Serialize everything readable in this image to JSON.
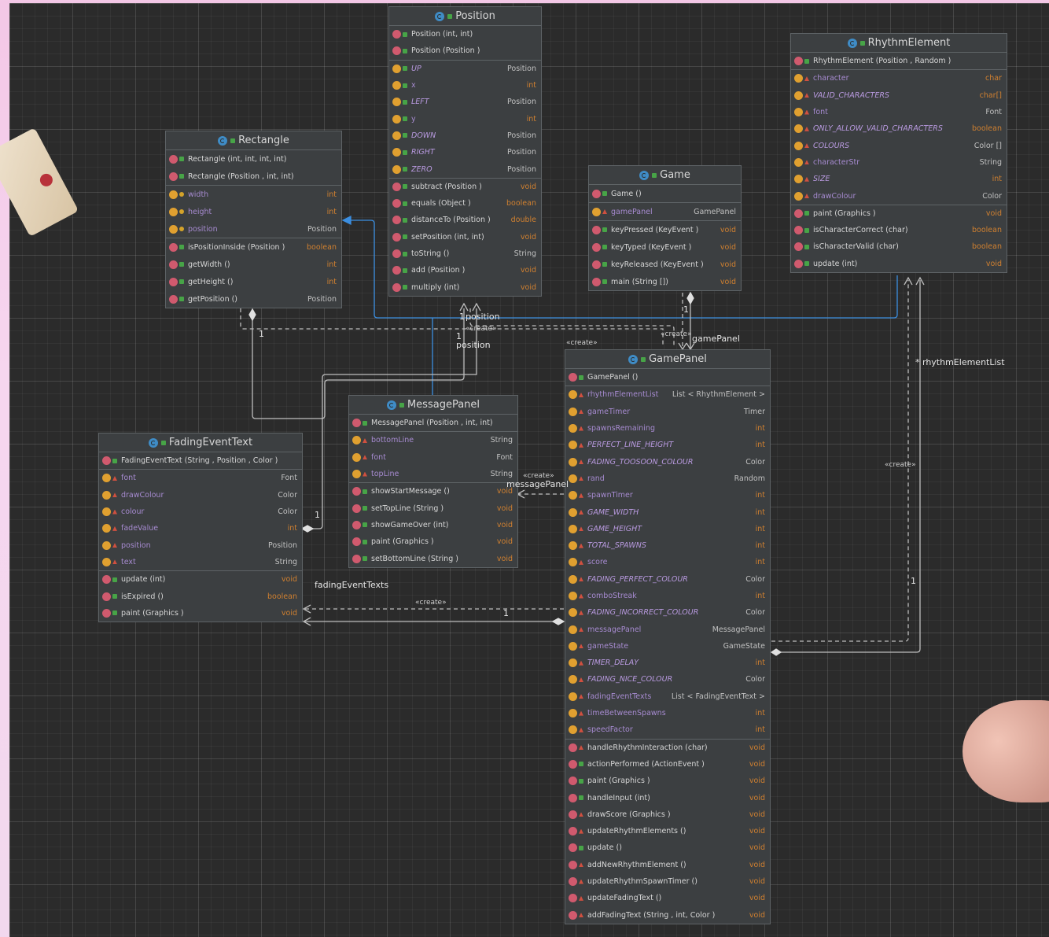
{
  "diagram": {
    "classes": [
      {
        "id": "Position",
        "name": "Position",
        "sections": [
          [
            {
              "k": "m",
              "v": "pub",
              "name": "Position",
              "args": "(int, int)",
              "type": ""
            },
            {
              "k": "m",
              "v": "pub",
              "name": "Position",
              "args": "(Position )",
              "type": ""
            }
          ],
          [
            {
              "k": "f",
              "v": "pub",
              "static": true,
              "name": "UP",
              "args": "",
              "type": "Position"
            },
            {
              "k": "f",
              "v": "pub",
              "name": "x",
              "args": "",
              "type": "int"
            },
            {
              "k": "f",
              "v": "pub",
              "static": true,
              "name": "LEFT",
              "args": "",
              "type": "Position"
            },
            {
              "k": "f",
              "v": "pub",
              "name": "y",
              "args": "",
              "type": "int"
            },
            {
              "k": "f",
              "v": "pub",
              "static": true,
              "name": "DOWN",
              "args": "",
              "type": "Position"
            },
            {
              "k": "f",
              "v": "pub",
              "static": true,
              "name": "RIGHT",
              "args": "",
              "type": "Position"
            },
            {
              "k": "f",
              "v": "pub",
              "static": true,
              "name": "ZERO",
              "args": "",
              "type": "Position"
            }
          ],
          [
            {
              "k": "m",
              "v": "pub",
              "name": "subtract",
              "args": "(Position )",
              "type": "void"
            },
            {
              "k": "m",
              "v": "pub",
              "name": "equals",
              "args": "(Object )",
              "type": "boolean"
            },
            {
              "k": "m",
              "v": "pub",
              "name": "distanceTo",
              "args": "(Position )",
              "type": "double"
            },
            {
              "k": "m",
              "v": "pub",
              "name": "setPosition",
              "args": "(int, int)",
              "type": "void"
            },
            {
              "k": "m",
              "v": "pub",
              "name": "toString",
              "args": "()",
              "type": "String"
            },
            {
              "k": "m",
              "v": "pub",
              "name": "add",
              "args": "(Position )",
              "type": "void"
            },
            {
              "k": "m",
              "v": "pub",
              "name": "multiply",
              "args": "(int)",
              "type": "void"
            }
          ]
        ]
      },
      {
        "id": "RhythmElement",
        "name": "RhythmElement",
        "sections": [
          [
            {
              "k": "m",
              "v": "pub",
              "name": "RhythmElement",
              "args": "(Position , Random )",
              "type": ""
            }
          ],
          [
            {
              "k": "f",
              "v": "priv",
              "name": "character",
              "args": "",
              "type": "char"
            },
            {
              "k": "f",
              "v": "priv",
              "static": true,
              "name": "VALID_CHARACTERS",
              "args": "",
              "type": "char[]"
            },
            {
              "k": "f",
              "v": "priv",
              "name": "font",
              "args": "",
              "type": "Font"
            },
            {
              "k": "f",
              "v": "priv",
              "static": true,
              "name": "ONLY_ALLOW_VALID_CHARACTERS",
              "args": "",
              "type": "boolean"
            },
            {
              "k": "f",
              "v": "priv",
              "static": true,
              "name": "COLOURS",
              "args": "",
              "type": "Color []"
            },
            {
              "k": "f",
              "v": "priv",
              "name": "characterStr",
              "args": "",
              "type": "String"
            },
            {
              "k": "f",
              "v": "priv",
              "static": true,
              "name": "SIZE",
              "args": "",
              "type": "int"
            },
            {
              "k": "f",
              "v": "priv",
              "name": "drawColour",
              "args": "",
              "type": "Color"
            }
          ],
          [
            {
              "k": "m",
              "v": "pub",
              "name": "paint",
              "args": "(Graphics )",
              "type": "void"
            },
            {
              "k": "m",
              "v": "pub",
              "name": "isCharacterCorrect",
              "args": "(char)",
              "type": "boolean"
            },
            {
              "k": "m",
              "v": "pub",
              "name": "isCharacterValid",
              "args": "(char)",
              "type": "boolean"
            },
            {
              "k": "m",
              "v": "pub",
              "name": "update",
              "args": "(int)",
              "type": "void"
            }
          ]
        ]
      },
      {
        "id": "Rectangle",
        "name": "Rectangle",
        "sections": [
          [
            {
              "k": "m",
              "v": "pub",
              "name": "Rectangle",
              "args": "(int, int, int, int)",
              "type": ""
            },
            {
              "k": "m",
              "v": "pub",
              "name": "Rectangle",
              "args": "(Position , int, int)",
              "type": ""
            }
          ],
          [
            {
              "k": "f",
              "v": "prot",
              "name": "width",
              "args": "",
              "type": "int"
            },
            {
              "k": "f",
              "v": "prot",
              "name": "height",
              "args": "",
              "type": "int"
            },
            {
              "k": "f",
              "v": "prot",
              "name": "position",
              "args": "",
              "type": "Position"
            }
          ],
          [
            {
              "k": "m",
              "v": "pub",
              "name": "isPositionInside",
              "args": "(Position )",
              "type": "boolean"
            },
            {
              "k": "m",
              "v": "pub",
              "name": "getWidth",
              "args": "()",
              "type": "int"
            },
            {
              "k": "m",
              "v": "pub",
              "name": "getHeight",
              "args": "()",
              "type": "int"
            },
            {
              "k": "m",
              "v": "pub",
              "name": "getPosition",
              "args": "()",
              "type": "Position"
            }
          ]
        ]
      },
      {
        "id": "Game",
        "name": "Game",
        "sections": [
          [
            {
              "k": "m",
              "v": "pub",
              "name": "Game",
              "args": "()",
              "type": ""
            }
          ],
          [
            {
              "k": "f",
              "v": "priv",
              "name": "gamePanel",
              "args": "",
              "type": "GamePanel"
            }
          ],
          [
            {
              "k": "m",
              "v": "pub",
              "name": "keyPressed",
              "args": "(KeyEvent )",
              "type": "void"
            },
            {
              "k": "m",
              "v": "pub",
              "name": "keyTyped",
              "args": "(KeyEvent )",
              "type": "void"
            },
            {
              "k": "m",
              "v": "pub",
              "name": "keyReleased",
              "args": "(KeyEvent )",
              "type": "void"
            },
            {
              "k": "m",
              "v": "pub",
              "name": "main",
              "args": "(String [])",
              "type": "void"
            }
          ]
        ]
      },
      {
        "id": "GamePanel",
        "name": "GamePanel",
        "sections": [
          [
            {
              "k": "m",
              "v": "pub",
              "name": "GamePanel",
              "args": "()",
              "type": ""
            }
          ],
          [
            {
              "k": "f",
              "v": "priv",
              "name": "rhythmElementList",
              "args": "",
              "type": "List < RhythmElement >"
            },
            {
              "k": "f",
              "v": "priv",
              "name": "gameTimer",
              "args": "",
              "type": "Timer"
            },
            {
              "k": "f",
              "v": "priv",
              "name": "spawnsRemaining",
              "args": "",
              "type": "int"
            },
            {
              "k": "f",
              "v": "priv",
              "static": true,
              "name": "PERFECT_LINE_HEIGHT",
              "args": "",
              "type": "int"
            },
            {
              "k": "f",
              "v": "priv",
              "static": true,
              "name": "FADING_TOOSOON_COLOUR",
              "args": "",
              "type": "Color"
            },
            {
              "k": "f",
              "v": "priv",
              "name": "rand",
              "args": "",
              "type": "Random"
            },
            {
              "k": "f",
              "v": "priv",
              "name": "spawnTimer",
              "args": "",
              "type": "int"
            },
            {
              "k": "f",
              "v": "priv",
              "static": true,
              "name": "GAME_WIDTH",
              "args": "",
              "type": "int"
            },
            {
              "k": "f",
              "v": "priv",
              "static": true,
              "name": "GAME_HEIGHT",
              "args": "",
              "type": "int"
            },
            {
              "k": "f",
              "v": "priv",
              "static": true,
              "name": "TOTAL_SPAWNS",
              "args": "",
              "type": "int"
            },
            {
              "k": "f",
              "v": "priv",
              "name": "score",
              "args": "",
              "type": "int"
            },
            {
              "k": "f",
              "v": "priv",
              "static": true,
              "name": "FADING_PERFECT_COLOUR",
              "args": "",
              "type": "Color"
            },
            {
              "k": "f",
              "v": "priv",
              "name": "comboStreak",
              "args": "",
              "type": "int"
            },
            {
              "k": "f",
              "v": "priv",
              "static": true,
              "name": "FADING_INCORRECT_COLOUR",
              "args": "",
              "type": "Color"
            },
            {
              "k": "f",
              "v": "priv",
              "name": "messagePanel",
              "args": "",
              "type": "MessagePanel"
            },
            {
              "k": "f",
              "v": "priv",
              "name": "gameState",
              "args": "",
              "type": "GameState"
            },
            {
              "k": "f",
              "v": "priv",
              "static": true,
              "name": "TIMER_DELAY",
              "args": "",
              "type": "int"
            },
            {
              "k": "f",
              "v": "priv",
              "static": true,
              "name": "FADING_NICE_COLOUR",
              "args": "",
              "type": "Color"
            },
            {
              "k": "f",
              "v": "priv",
              "name": "fadingEventTexts",
              "args": "",
              "type": "List < FadingEventText >"
            },
            {
              "k": "f",
              "v": "priv",
              "name": "timeBetweenSpawns",
              "args": "",
              "type": "int"
            },
            {
              "k": "f",
              "v": "priv",
              "name": "speedFactor",
              "args": "",
              "type": "int"
            }
          ],
          [
            {
              "k": "m",
              "v": "priv",
              "name": "handleRhythmInteraction",
              "args": "(char)",
              "type": "void"
            },
            {
              "k": "m",
              "v": "pub",
              "name": "actionPerformed",
              "args": "(ActionEvent )",
              "type": "void"
            },
            {
              "k": "m",
              "v": "pub",
              "name": "paint",
              "args": "(Graphics )",
              "type": "void"
            },
            {
              "k": "m",
              "v": "pub",
              "name": "handleInput",
              "args": "(int)",
              "type": "void"
            },
            {
              "k": "m",
              "v": "priv",
              "name": "drawScore",
              "args": "(Graphics )",
              "type": "void"
            },
            {
              "k": "m",
              "v": "priv",
              "name": "updateRhythmElements",
              "args": "()",
              "type": "void"
            },
            {
              "k": "m",
              "v": "pub",
              "name": "update",
              "args": "()",
              "type": "void"
            },
            {
              "k": "m",
              "v": "priv",
              "name": "addNewRhythmElement",
              "args": "()",
              "type": "void"
            },
            {
              "k": "m",
              "v": "priv",
              "name": "updateRhythmSpawnTimer",
              "args": "()",
              "type": "void"
            },
            {
              "k": "m",
              "v": "priv",
              "name": "updateFadingText",
              "args": "()",
              "type": "void"
            },
            {
              "k": "m",
              "v": "priv",
              "name": "addFadingText",
              "args": "(String , int, Color )",
              "type": "void"
            }
          ]
        ]
      },
      {
        "id": "MessagePanel",
        "name": "MessagePanel",
        "sections": [
          [
            {
              "k": "m",
              "v": "pub",
              "name": "MessagePanel",
              "args": "(Position , int, int)",
              "type": ""
            }
          ],
          [
            {
              "k": "f",
              "v": "priv",
              "name": "bottomLine",
              "args": "",
              "type": "String"
            },
            {
              "k": "f",
              "v": "priv",
              "name": "font",
              "args": "",
              "type": "Font"
            },
            {
              "k": "f",
              "v": "priv",
              "name": "topLine",
              "args": "",
              "type": "String"
            }
          ],
          [
            {
              "k": "m",
              "v": "pub",
              "name": "showStartMessage",
              "args": "()",
              "type": "void"
            },
            {
              "k": "m",
              "v": "pub",
              "name": "setTopLine",
              "args": "(String )",
              "type": "void"
            },
            {
              "k": "m",
              "v": "pub",
              "name": "showGameOver",
              "args": "(int)",
              "type": "void"
            },
            {
              "k": "m",
              "v": "pub",
              "name": "paint",
              "args": "(Graphics )",
              "type": "void"
            },
            {
              "k": "m",
              "v": "pub",
              "name": "setBottomLine",
              "args": "(String )",
              "type": "void"
            }
          ]
        ]
      },
      {
        "id": "FadingEventText",
        "name": "FadingEventText",
        "sections": [
          [
            {
              "k": "m",
              "v": "pub",
              "name": "FadingEventText",
              "args": "(String , Position , Color )",
              "type": ""
            }
          ],
          [
            {
              "k": "f",
              "v": "priv",
              "name": "font",
              "args": "",
              "type": "Font"
            },
            {
              "k": "f",
              "v": "priv",
              "name": "drawColour",
              "args": "",
              "type": "Color"
            },
            {
              "k": "f",
              "v": "priv",
              "name": "colour",
              "args": "",
              "type": "Color"
            },
            {
              "k": "f",
              "v": "priv",
              "name": "fadeValue",
              "args": "",
              "type": "int"
            },
            {
              "k": "f",
              "v": "priv",
              "name": "position",
              "args": "",
              "type": "Position"
            },
            {
              "k": "f",
              "v": "priv",
              "name": "text",
              "args": "",
              "type": "String"
            }
          ],
          [
            {
              "k": "m",
              "v": "pub",
              "name": "update",
              "args": "(int)",
              "type": "void"
            },
            {
              "k": "m",
              "v": "pub",
              "name": "isExpired",
              "args": "()",
              "type": "boolean"
            },
            {
              "k": "m",
              "v": "pub",
              "name": "paint",
              "args": "(Graphics )",
              "type": "void"
            }
          ]
        ]
      }
    ],
    "labels": {
      "position1": "1",
      "position_a": "position",
      "create_a": "«create»",
      "one_b": "1",
      "position_b": "position",
      "create_game": "«create»",
      "one_game": "1",
      "gamepanel_role": "gamePanel",
      "create_gp": "«create»",
      "rhythm_role": "rhythmElementList",
      "rhythm_star": "*",
      "create_right": "«create»",
      "one_right": "1",
      "one_rect": "1",
      "one_fade": "1",
      "create_msg": "«create»",
      "message_role": "messagePanel",
      "fading_role": "fadingEventTexts",
      "create_fade": "«create»",
      "one_fade2": "1"
    }
  }
}
